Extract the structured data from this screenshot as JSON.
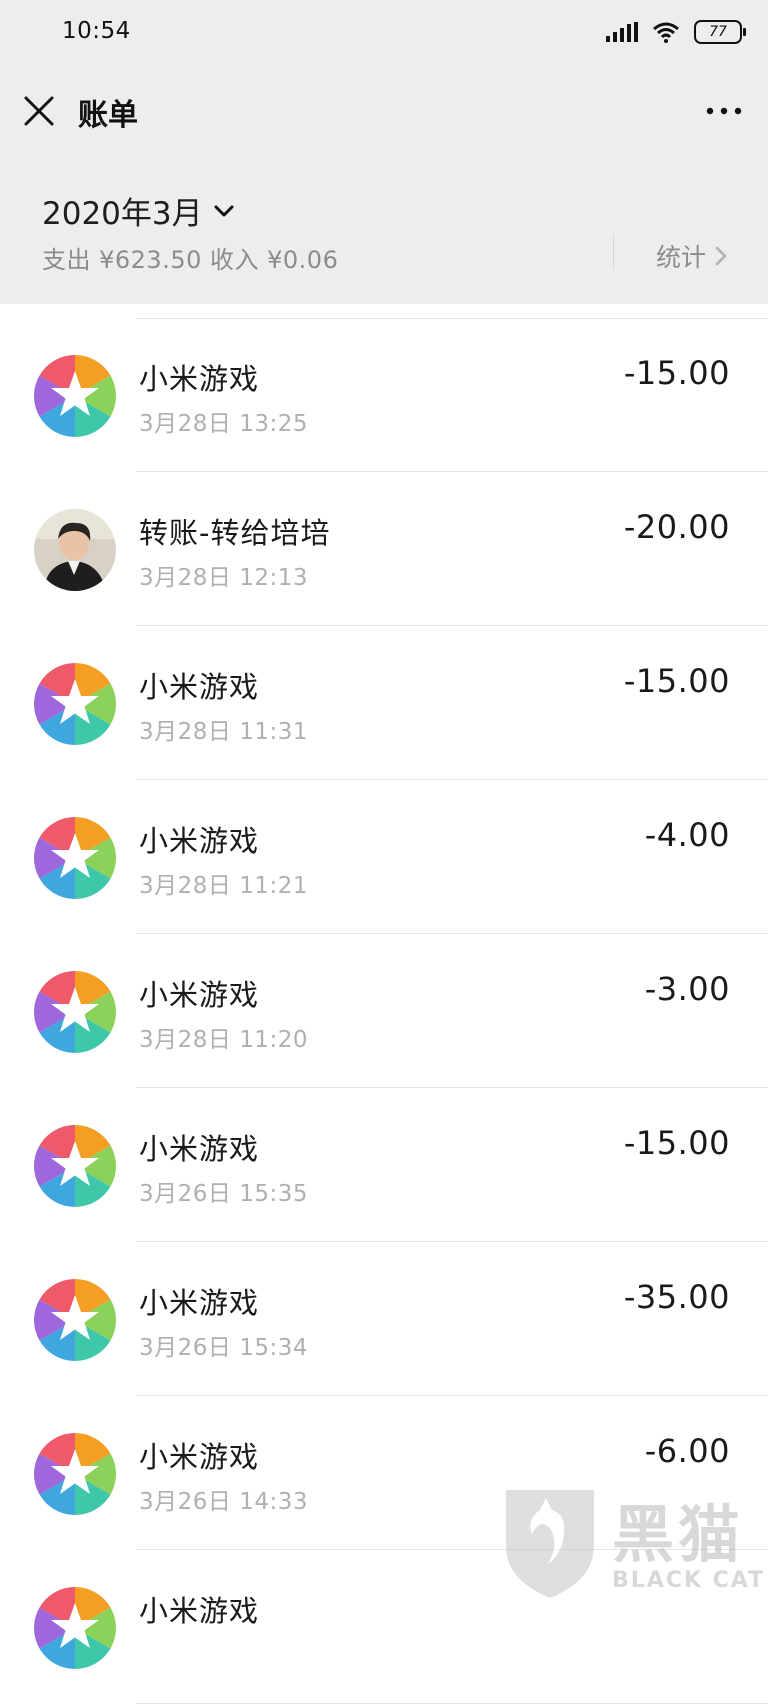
{
  "status_bar": {
    "time": "10:54",
    "battery": "77"
  },
  "nav": {
    "title": "账单"
  },
  "summary": {
    "month": "2020年3月",
    "totals": "支出 ¥623.50 收入 ¥0.06",
    "stats_label": "统计"
  },
  "transactions": [
    {
      "title": "小米游戏",
      "time": "3月28日 13:25",
      "amount": "-15.00",
      "icon": "xiaomi-game-star-icon"
    },
    {
      "title": "转账-转给培培",
      "time": "3月28日 12:13",
      "amount": "-20.00",
      "icon": "user-avatar"
    },
    {
      "title": "小米游戏",
      "time": "3月28日 11:31",
      "amount": "-15.00",
      "icon": "xiaomi-game-star-icon"
    },
    {
      "title": "小米游戏",
      "time": "3月28日 11:21",
      "amount": "-4.00",
      "icon": "xiaomi-game-star-icon"
    },
    {
      "title": "小米游戏",
      "time": "3月28日 11:20",
      "amount": "-3.00",
      "icon": "xiaomi-game-star-icon"
    },
    {
      "title": "小米游戏",
      "time": "3月26日 15:35",
      "amount": "-15.00",
      "icon": "xiaomi-game-star-icon"
    },
    {
      "title": "小米游戏",
      "time": "3月26日 15:34",
      "amount": "-35.00",
      "icon": "xiaomi-game-star-icon"
    },
    {
      "title": "小米游戏",
      "time": "3月26日 14:33",
      "amount": "-6.00",
      "icon": "xiaomi-game-star-icon"
    },
    {
      "title": "小米游戏",
      "time": "",
      "amount": "",
      "icon": "xiaomi-game-star-icon"
    }
  ],
  "watermark": {
    "text": "黑猫",
    "sub": "BLACK CAT"
  }
}
